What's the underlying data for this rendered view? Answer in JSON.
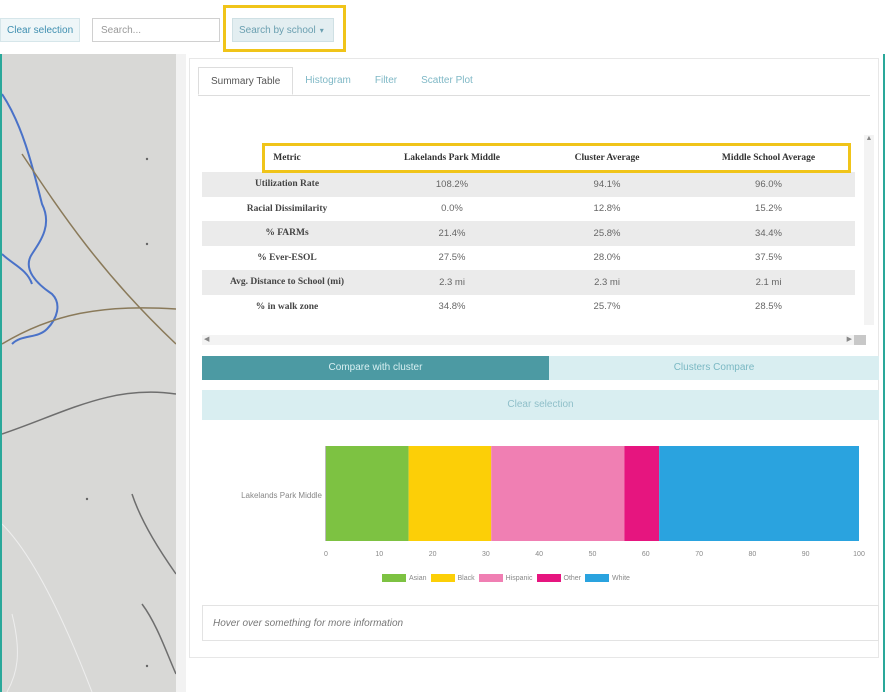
{
  "toolbar": {
    "clear_selection_label": "Clear selection",
    "search_placeholder": "Search...",
    "search_school_label": "Search by school"
  },
  "tabs": [
    {
      "label": "Summary Table",
      "active": true
    },
    {
      "label": "Histogram",
      "active": false
    },
    {
      "label": "Filter",
      "active": false
    },
    {
      "label": "Scatter Plot",
      "active": false
    }
  ],
  "table": {
    "headers": [
      "Metric",
      "Lakelands Park Middle",
      "Cluster Average",
      "Middle School Average"
    ],
    "rows": [
      [
        "Utilization Rate",
        "108.2%",
        "94.1%",
        "96.0%"
      ],
      [
        "Racial Dissimilarity",
        "0.0%",
        "12.8%",
        "15.2%"
      ],
      [
        "% FARMs",
        "21.4%",
        "25.8%",
        "34.4%"
      ],
      [
        "% Ever-ESOL",
        "27.5%",
        "28.0%",
        "37.5%"
      ],
      [
        "Avg. Distance to School (mi)",
        "2.3 mi",
        "2.3 mi",
        "2.1 mi"
      ],
      [
        "% in walk zone",
        "34.8%",
        "25.7%",
        "28.5%"
      ]
    ]
  },
  "buttons": {
    "compare_cluster": "Compare with cluster",
    "cluster_compare": "Clusters Compare",
    "clear_selection": "Clear selection"
  },
  "chart_data": {
    "type": "bar",
    "orientation": "horizontal-stacked",
    "categories": [
      "Lakelands Park Middle"
    ],
    "series": [
      {
        "name": "Asian",
        "values": [
          15.5
        ],
        "color": "#7dc242"
      },
      {
        "name": "Black",
        "values": [
          15.5
        ],
        "color": "#fccf07"
      },
      {
        "name": "Hispanic",
        "values": [
          25
        ],
        "color": "#f07fb3"
      },
      {
        "name": "Other",
        "values": [
          6.5
        ],
        "color": "#e6157f"
      },
      {
        "name": "White",
        "values": [
          37.5
        ],
        "color": "#2aa3df"
      }
    ],
    "xlim": [
      0,
      100
    ],
    "xticks": [
      "0",
      "10",
      "20",
      "30",
      "40",
      "50",
      "60",
      "70",
      "80",
      "90",
      "100"
    ],
    "legend": "bottom"
  },
  "hover_text": "Hover over something for more information"
}
